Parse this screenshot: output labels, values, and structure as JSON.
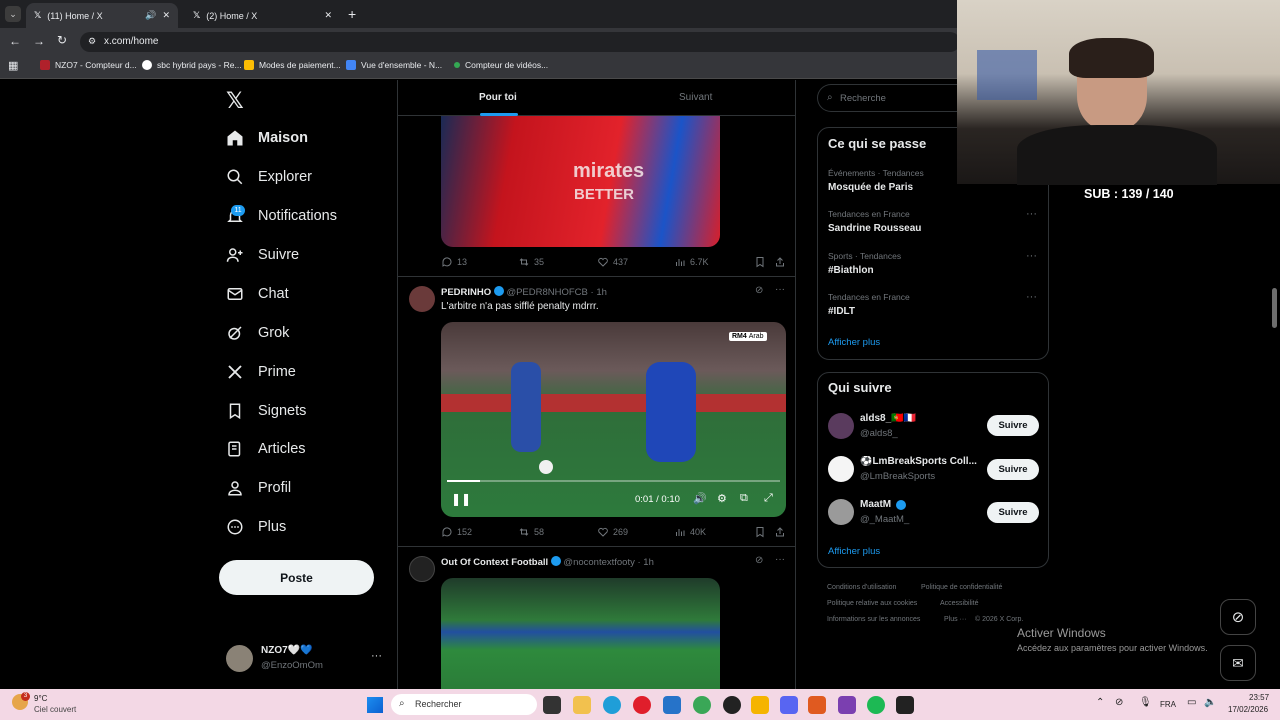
{
  "browser": {
    "tabs": [
      {
        "title": "(11) Home / X"
      },
      {
        "title": "(2) Home / X"
      }
    ],
    "url": "x.com/home",
    "bookmarks": [
      "NZO7 - Compteur d...",
      "sbc hybrid pays - Re...",
      "Modes de paiement...",
      "Vue d'ensemble - N...",
      "Compteur de vidéos..."
    ]
  },
  "nav": {
    "items": [
      "Maison",
      "Explorer",
      "Notifications",
      "Suivre",
      "Chat",
      "Grok",
      "Prime",
      "Signets",
      "Articles",
      "Profil",
      "Plus"
    ],
    "notif_count": "11",
    "post_label": "Poste",
    "account": {
      "name": "NZO7🤍💙",
      "handle": "@EnzoOmOm"
    }
  },
  "feed": {
    "tabs": [
      "Pour toi",
      "Suivant"
    ],
    "post1": {
      "replies": "13",
      "reposts": "35",
      "likes": "437",
      "views": "6.7K"
    },
    "post2": {
      "name": "PEDRINHO",
      "handle": "@PEDR8NHOFCB",
      "time": "· 1h",
      "text": "L'arbitre n'a pas sifflé penalty mdrrr.",
      "video_time": "0:01 / 0:10",
      "badge": "RM4",
      "badge2": "Arab",
      "replies": "152",
      "reposts": "58",
      "likes": "269",
      "views": "40K",
      "progress": 0.1
    },
    "post3": {
      "name": "Out Of Context Football",
      "handle": "@nocontextfooty",
      "time": "· 1h"
    }
  },
  "sidebar": {
    "search_placeholder": "Recherche",
    "trends_title": "Ce qui se passe",
    "trends": [
      {
        "cat": "Événements · Tendances",
        "name": "Mosquée de Paris"
      },
      {
        "cat": "Tendances en France",
        "name": "Sandrine Rousseau"
      },
      {
        "cat": "Sports · Tendances",
        "name": "#Biathlon"
      },
      {
        "cat": "Tendances en France",
        "name": "#IDLT"
      }
    ],
    "show_more": "Afficher plus",
    "who_title": "Qui suivre",
    "who": [
      {
        "name": "alds8_🇵🇹🇫🇷",
        "handle": "@alds8_"
      },
      {
        "name": "⚽LmBreakSports Coll...",
        "handle": "@LmBreakSports"
      },
      {
        "name": "MaatM",
        "handle": "@_MaatM_"
      }
    ],
    "follow_label": "Suivre",
    "footer": [
      "Conditions d'utilisation",
      "Politique de confidentialité",
      "Politique relative aux cookies",
      "Accessibilité",
      "Informations sur les annonces",
      "Plus ···",
      "© 2026 X Corp."
    ]
  },
  "overlay": {
    "sub": "SUB : 139 / 140",
    "activate_title": "Activer Windows",
    "activate_sub": "Accédez aux paramètres pour activer Windows."
  },
  "taskbar": {
    "weather_temp": "9°C",
    "weather_desc": "Ciel couvert",
    "search": "Rechercher",
    "lang": "FRA",
    "time": "23:57",
    "date": "17/02/2026",
    "badge": "3"
  }
}
